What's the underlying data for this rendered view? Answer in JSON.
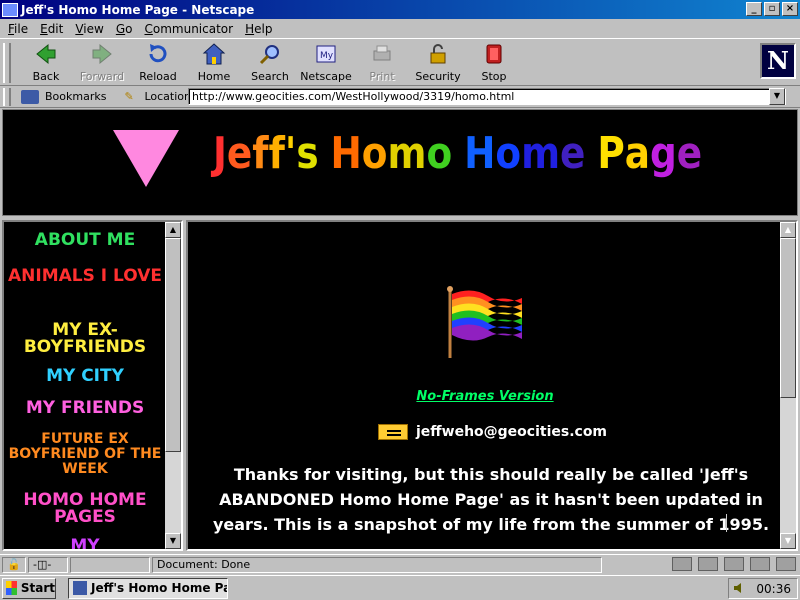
{
  "window": {
    "title": "Jeff's Homo Home Page - Netscape"
  },
  "menu": [
    {
      "pre": "",
      "key": "F",
      "post": "ile"
    },
    {
      "pre": "",
      "key": "E",
      "post": "dit"
    },
    {
      "pre": "",
      "key": "V",
      "post": "iew"
    },
    {
      "pre": "",
      "key": "G",
      "post": "o"
    },
    {
      "pre": "",
      "key": "C",
      "post": "ommunicator"
    },
    {
      "pre": "",
      "key": "H",
      "post": "elp"
    }
  ],
  "toolbar": {
    "back": "Back",
    "forward": "Forward",
    "reload": "Reload",
    "home": "Home",
    "search": "Search",
    "netscape": "Netscape",
    "print": "Print",
    "security": "Security",
    "stop": "Stop"
  },
  "location_bar": {
    "bookmarks_label": "Bookmarks",
    "location_label": "Location:",
    "url": "http://www.geocities.com/WestHollywood/3319/homo.html"
  },
  "banner": {
    "title_letters": [
      "J",
      "e",
      "f",
      "f",
      "'",
      "s",
      " ",
      "H",
      "o",
      "m",
      "o",
      " ",
      "H",
      "o",
      "m",
      "e",
      " ",
      "P",
      "a",
      "g",
      "e"
    ],
    "title_colors": [
      "#ff3030",
      "#ff5a1e",
      "#ff8a14",
      "#ffb000",
      "#ffd000",
      "#e0e000",
      "#ffffff",
      "#ff6a00",
      "#ffa000",
      "#e0d000",
      "#40d020",
      "#ffffff",
      "#1060ff",
      "#1040ff",
      "#2020e0",
      "#4020c0",
      "#ffffff",
      "#ffe000",
      "#ffd000",
      "#c020e0",
      "#a020c0"
    ],
    "triangle_color": "#ff88e0"
  },
  "nav": [
    {
      "label": "About Me",
      "color": "#30e060"
    },
    {
      "label": "Animals I Love",
      "color": "#ff3030"
    },
    {
      "label": "My Ex-Boyfriends",
      "color": "#ffee40"
    },
    {
      "label": "My City",
      "color": "#30d0ff"
    },
    {
      "label": "My Friends",
      "color": "#ff60e0"
    },
    {
      "label": "Future Ex Boyfriend of the Week",
      "color": "#ff8a20"
    },
    {
      "label": "Homo Home Pages",
      "color": "#ff50c8"
    },
    {
      "label": "My",
      "color": "#d040ff"
    }
  ],
  "main": {
    "noframes_link": "No-Frames Version",
    "email": "jeffweho@geocities.com",
    "intro": "Thanks for visiting, but this should really be called 'Jeff's ABANDONED Homo Home Page' as it hasn't been updated in years. This is a snapshot of my life from the summer of 1995."
  },
  "status": {
    "text": "Document: Done"
  },
  "taskbar": {
    "start": "Start",
    "task": "Jeff's Homo Home Pa...",
    "clock": "00:36"
  },
  "colors": {
    "titlebar": "#000080",
    "page_bg": "#000000",
    "link_green": "#00ff66"
  }
}
